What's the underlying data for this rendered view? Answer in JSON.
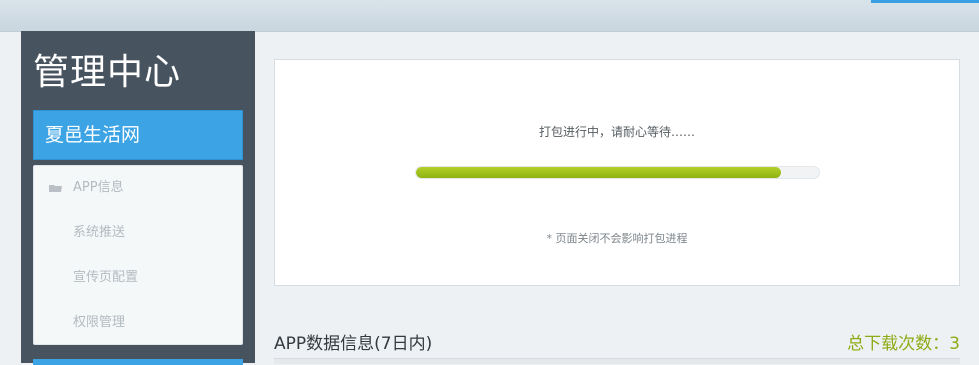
{
  "sidebar": {
    "title": "管理中心",
    "site_button": "夏邑生活网",
    "menu": [
      {
        "label": "APP信息",
        "icon": "folder-icon"
      },
      {
        "label": "系统推送"
      },
      {
        "label": "宣传页配置"
      },
      {
        "label": "权限管理"
      }
    ]
  },
  "packaging": {
    "status": "打包进行中，请耐心等待……",
    "progress": 0.906,
    "note": "* 页面关闭不会影响打包进程"
  },
  "stats": {
    "title": "APP数据信息(7日内)",
    "download_label": "总下载次数：",
    "download_count": "3"
  },
  "colors": {
    "sidebar_bg": "#47535f",
    "accent_blue": "#3ca3e4",
    "progress_green": "#9fc21c",
    "count_green": "#8eab16"
  }
}
